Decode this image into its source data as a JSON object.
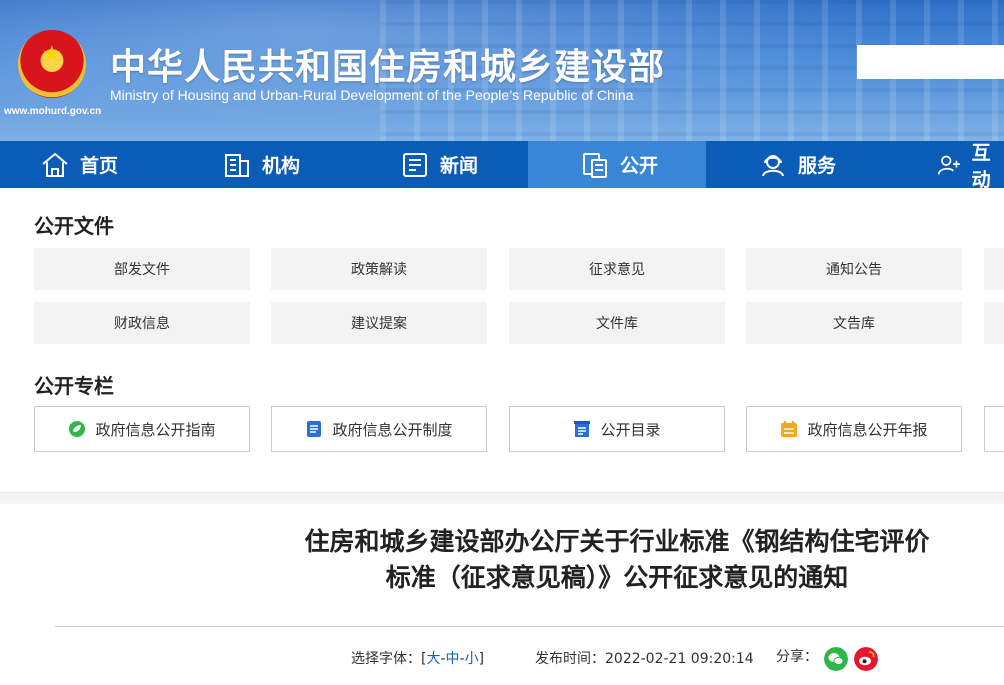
{
  "header": {
    "title_cn": "中华人民共和国住房和城乡建设部",
    "title_en": "Ministry of Housing and Urban-Rural Development of the People’s Republic of China",
    "site_url": "www.mohurd.gov.cn"
  },
  "nav": {
    "items": [
      {
        "label": "首页",
        "icon": "home-icon"
      },
      {
        "label": "机构",
        "icon": "building-icon"
      },
      {
        "label": "新闻",
        "icon": "news-icon"
      },
      {
        "label": "公开",
        "icon": "document-icon",
        "active": true
      },
      {
        "label": "服务",
        "icon": "service-icon"
      },
      {
        "label": "互动",
        "icon": "person-interact-icon"
      }
    ]
  },
  "public_docs": {
    "title": "公开文件",
    "items": [
      "部发文件",
      "政策解读",
      "征求意见",
      "通知公告",
      "财政信息",
      "建议提案",
      "文件库",
      "文告库"
    ]
  },
  "public_columns": {
    "title": "公开专栏",
    "items": [
      {
        "label": "政府信息公开指南",
        "icon": "leaf-icon",
        "color": "#2fb54a"
      },
      {
        "label": "政府信息公开制度",
        "icon": "list-doc-icon",
        "color": "#2a6fd6"
      },
      {
        "label": "公开目录",
        "icon": "catalog-icon",
        "color": "#2a6fd6"
      },
      {
        "label": "政府信息公开年报",
        "icon": "calendar-icon",
        "color": "#f5a623"
      }
    ]
  },
  "article": {
    "title_line1": "住房和城乡建设部办公厅关于行业标准《钢结构住宅评价",
    "title_line2": "标准（征求意见稿）》公开征求意见的通知",
    "font_label": "选择字体：[",
    "font_large": "大",
    "font_mid": "中",
    "font_small": "小",
    "font_close": "]",
    "sep": "-",
    "publish_label": "发布时间：",
    "publish_time": "2022-02-21 09:20:14",
    "share_label": "分享："
  },
  "colors": {
    "nav_bg": "#0a5cb7",
    "nav_active": "#3a86d6",
    "link": "#1a5fb4"
  }
}
